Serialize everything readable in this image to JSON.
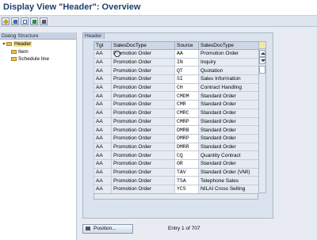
{
  "window": {
    "title": "Display View \"Header\": Overview"
  },
  "toolbar": {
    "buttons": [
      {
        "icon": "edit-icon"
      },
      {
        "icon": "details-icon"
      },
      {
        "icon": "select-all-icon"
      },
      {
        "icon": "select-block-icon"
      },
      {
        "icon": "deselect-icon"
      }
    ]
  },
  "dialog_structure": {
    "title": "Dialog Structure",
    "items": [
      {
        "label": "Header",
        "selected": true
      },
      {
        "label": "Item"
      },
      {
        "label": "Schedule line"
      }
    ]
  },
  "panel": {
    "tab": "Header"
  },
  "table": {
    "columns": [
      "Tgt",
      "SalesDocType",
      "Source",
      "SalesDocType"
    ],
    "rows": [
      [
        "AA",
        "Promotion Order",
        "AA",
        "Promotion Order"
      ],
      [
        "AA",
        "Promotion Order",
        "IN",
        "Inquiry"
      ],
      [
        "AA",
        "Promotion Order",
        "QT",
        "Quotation"
      ],
      [
        "AA",
        "Promotion Order",
        "SI",
        "Sales Information"
      ],
      [
        "AA",
        "Promotion Order",
        "CH",
        "Contract Handling"
      ],
      [
        "AA",
        "Promotion Order",
        "CMDM",
        "Standard Order"
      ],
      [
        "AA",
        "Promotion Order",
        "CMR",
        "Standard Order"
      ],
      [
        "AA",
        "Promotion Order",
        "CMRC",
        "Standard Order"
      ],
      [
        "AA",
        "Promotion Order",
        "CMRP",
        "Standard Order"
      ],
      [
        "AA",
        "Promotion Order",
        "DMRB",
        "Standard Order"
      ],
      [
        "AA",
        "Promotion Order",
        "DMRP",
        "Standard Order"
      ],
      [
        "AA",
        "Promotion Order",
        "DMRR",
        "Standard Order"
      ],
      [
        "AA",
        "Promotion Order",
        "CQ",
        "Quantity Contract"
      ],
      [
        "AA",
        "Promotion Order",
        "OR",
        "Standard Order"
      ],
      [
        "AA",
        "Promotion Order",
        "TAV",
        "Standard Order (VMI)"
      ],
      [
        "AA",
        "Promotion Order",
        "TSA",
        "Telephone Sales"
      ],
      [
        "AA",
        "Promotion Order",
        "YCS",
        "NILAI Cross Selling"
      ]
    ]
  },
  "footer": {
    "position_button": "Position...",
    "entry_text": "Entry 1 of 707"
  }
}
